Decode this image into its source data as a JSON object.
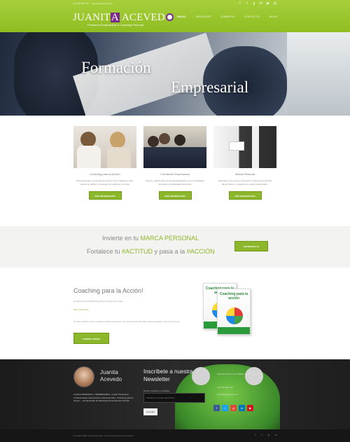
{
  "topbar": {
    "phone": "+34 000 000 000",
    "email": "juanita@acevedo.com"
  },
  "social_icons": [
    "facebook-icon",
    "twitter-icon",
    "google-plus-icon",
    "linkedin-icon",
    "youtube-icon",
    "instagram-icon"
  ],
  "logo": {
    "part1": "JUANIT",
    "boxed": "A",
    "part2": " ACEVED"
  },
  "tagline": "Formación Empresarial & Coaching Personal",
  "nav": [
    "Inicio",
    "Servicios",
    "Sobre mí",
    "Contacto",
    "Blog"
  ],
  "hero": {
    "line1": "Formación",
    "line2": "Empresarial"
  },
  "features": [
    {
      "label": "Coaching para la Acción",
      "text": "Para empresas y personas que quieren dar el siguiente paso, mejorar su actitud y conseguir sus objetivos con éxito.",
      "button": "Más información"
    },
    {
      "label": "Formación Empresarial",
      "text": "Cursos y talleres para empresas adaptados a sus necesidades, formación en habilidades directivas.",
      "button": "Más información"
    },
    {
      "label": "Marca Personal",
      "text": "Descubre cómo crear y potenciar tu marca personal para diferenciarte y conseguir tus metas profesionales.",
      "button": "Más información"
    }
  ],
  "band": {
    "line1_pre": "Invierte en tu ",
    "line1_hl": "MARCA PERSONAL",
    "line2_pre": "Fortalece tu ",
    "line2_hl1": "#ACTITUD",
    "line2_mid": " y pasa a la ",
    "line2_hl2": "#ACCIÓN",
    "button": "INFÓRMATE YA"
  },
  "coaching": {
    "title": "Coaching para la Acción!",
    "subtitle": "Herramientas de Marketing para conseguir tus metas",
    "link": "Más información",
    "description": "Un libro práctico que te ayudará a pasar a la acción con herramientas sencillas para conseguir lo que te propones.",
    "button": "Compra ahora",
    "book_title": "Coaching para la acción"
  },
  "footer": {
    "name": "Juanita Acevedo",
    "bio": "COACH PERSONAL Y EMPRESARIAL, Coach Personal & Conferenciante Internacional. Autora del libro: 'Coaching para la Acción' – Herramientas de Marketing Personal para Triunfar.",
    "newsletter_title": "Inscríbete a nuestra Newsletter",
    "newsletter_sub": "Recibe nuestras novedades",
    "newsletter_placeholder": "Introduce tu correo electrónico",
    "newsletter_button": "Suscribir",
    "address": "Calle Sin Nombre 00, 00000 Ciudad, España",
    "phone": "+34 000 000 000",
    "email": "juanita@acevedo.com",
    "social_icons": [
      "facebook-icon",
      "twitter-icon",
      "google-plus-icon",
      "linkedin-icon",
      "youtube-icon"
    ],
    "social_colors": [
      "#3b5998",
      "#1da1f2",
      "#dd4b39",
      "#0077b5",
      "#cc181e"
    ]
  },
  "bottom": {
    "copyright": "Copyright 2016 Juanita Acevedo. Todos los derechos reservados.",
    "icons": [
      "facebook-icon",
      "twitter-icon",
      "google-plus-icon",
      "linkedin-icon"
    ]
  },
  "colors": {
    "accent": "#8cb72a",
    "brand_purple": "#7b2a8b"
  }
}
